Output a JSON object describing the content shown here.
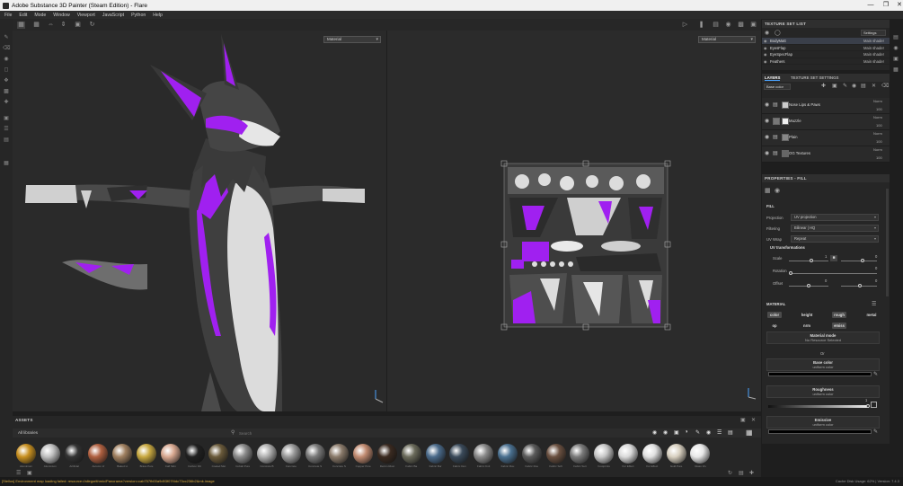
{
  "window": {
    "title": "Adobe Substance 3D Painter (Steam Edition) - Flare",
    "controls": [
      "—",
      "❐",
      "✕"
    ]
  },
  "menu": [
    "File",
    "Edit",
    "Mode",
    "Window",
    "Viewport",
    "JavaScript",
    "Python",
    "Help"
  ],
  "viewport": {
    "left_dropdown": "Material",
    "right_dropdown": "Material"
  },
  "texture_set_list": {
    "title": "TEXTURE SET LIST",
    "settings_label": "Settings",
    "items": [
      {
        "name": "BodyMatt",
        "shader": "Main shader"
      },
      {
        "name": "EyesFlap",
        "shader": "Main shader"
      },
      {
        "name": "EyeSpecFlap",
        "shader": "Main shader"
      },
      {
        "name": "Feathers",
        "shader": "Main shader"
      }
    ]
  },
  "layers": {
    "tab1": "LAYERS",
    "tab2": "TEXTURE SET SETTINGS",
    "channel": "Base color",
    "items": [
      {
        "name": "Nose Lips & Paws",
        "blend": "Norm",
        "opacity": "100"
      },
      {
        "name": "Muzzle",
        "blend": "Norm",
        "opacity": "100"
      },
      {
        "name": "Plain",
        "blend": "Norm",
        "opacity": "100"
      },
      {
        "name": "OG Textures",
        "blend": "Norm",
        "opacity": "100"
      }
    ]
  },
  "properties": {
    "title": "PROPERTIES - FILL",
    "section": "FILL",
    "projection_label": "Projection",
    "projection": "UV projection",
    "filtering_label": "Filtering",
    "filtering": "Bilinear | HQ",
    "uvwrap_label": "UV Wrap",
    "uvwrap": "Repeat",
    "uvtrans": "UV transformations",
    "scale_label": "Scale",
    "scale_val": "1",
    "scale_val2": "0",
    "rotation_label": "Rotation",
    "rotation_val": "0",
    "offset_label": "Offset",
    "offset_val": "0",
    "offset_val2": "0",
    "material_title": "MATERIAL",
    "chips": [
      "color",
      "height",
      "rough",
      "metal",
      "nrm",
      "emiss",
      "op"
    ],
    "material_mode": "Material mode",
    "no_resource": "No Resource Selected",
    "or": "Or",
    "base_color": "Base color",
    "uniform1": "uniform color",
    "roughness": "Roughness",
    "uniform2": "uniform color",
    "rough_val": "1",
    "emissive": "Emissive",
    "uniform3": "uniform color"
  },
  "assets": {
    "title": "ASSETS",
    "library": "All libraries",
    "search_placeholder": "Search",
    "labels": [
      "Aluminium",
      "Aluminium",
      "Artificial",
      "Autumn Lf",
      "Baked Lt",
      "Brass Pure",
      "Calf Skin",
      "Carbon Fib",
      "Coated Met",
      "Cobalt Pure",
      "Concrete B",
      "Concrete",
      "Concrete S",
      "Concrete S",
      "Copper Pure",
      "Denim Rivet",
      "Fabric Ba",
      "Fabric Bur",
      "Fabric Den",
      "Fabric Knit",
      "Fabric Rou",
      "Fabric Rou",
      "Fabric Soft",
      "Fabric Suit",
      "Footprints",
      "Fur Effect",
      "Fur Effect",
      "Gold Pure",
      "Glass Vis"
    ]
  },
  "status": {
    "message": "[Stellus] Environment map loading failed: resource://allegorithmic/Panorama?version=cab757fb00a9d93f07f4dc73cc236b2&mk.image",
    "cache": "Cache Disk Usage:",
    "cache_val": "62% | Version: 7.4.3"
  }
}
